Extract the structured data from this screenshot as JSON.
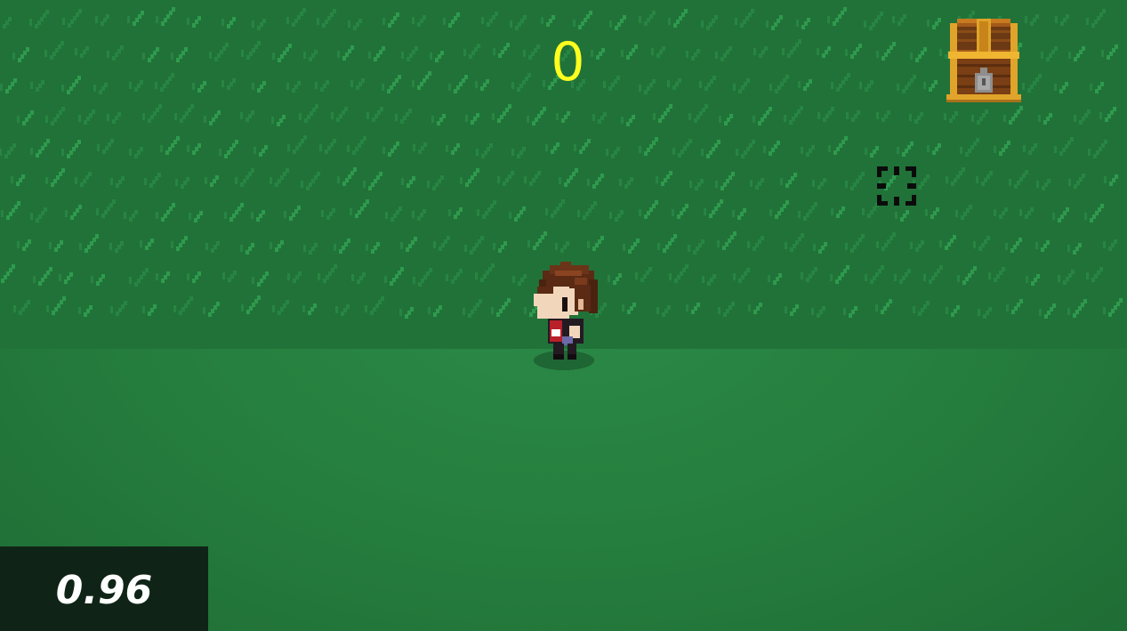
{
  "hud": {
    "score": "0",
    "fps": "0.96"
  },
  "icons": {
    "chest": "treasure-chest-icon",
    "target": "target-reticle-icon",
    "player": "player-character-sprite"
  },
  "colors": {
    "score_text": "#ffff1f",
    "grass_dark": "#217238",
    "grass_light": "#2e9a4e",
    "ground": "#26803f",
    "fps_panel": "#0f2416",
    "fps_text": "#ffffff"
  }
}
